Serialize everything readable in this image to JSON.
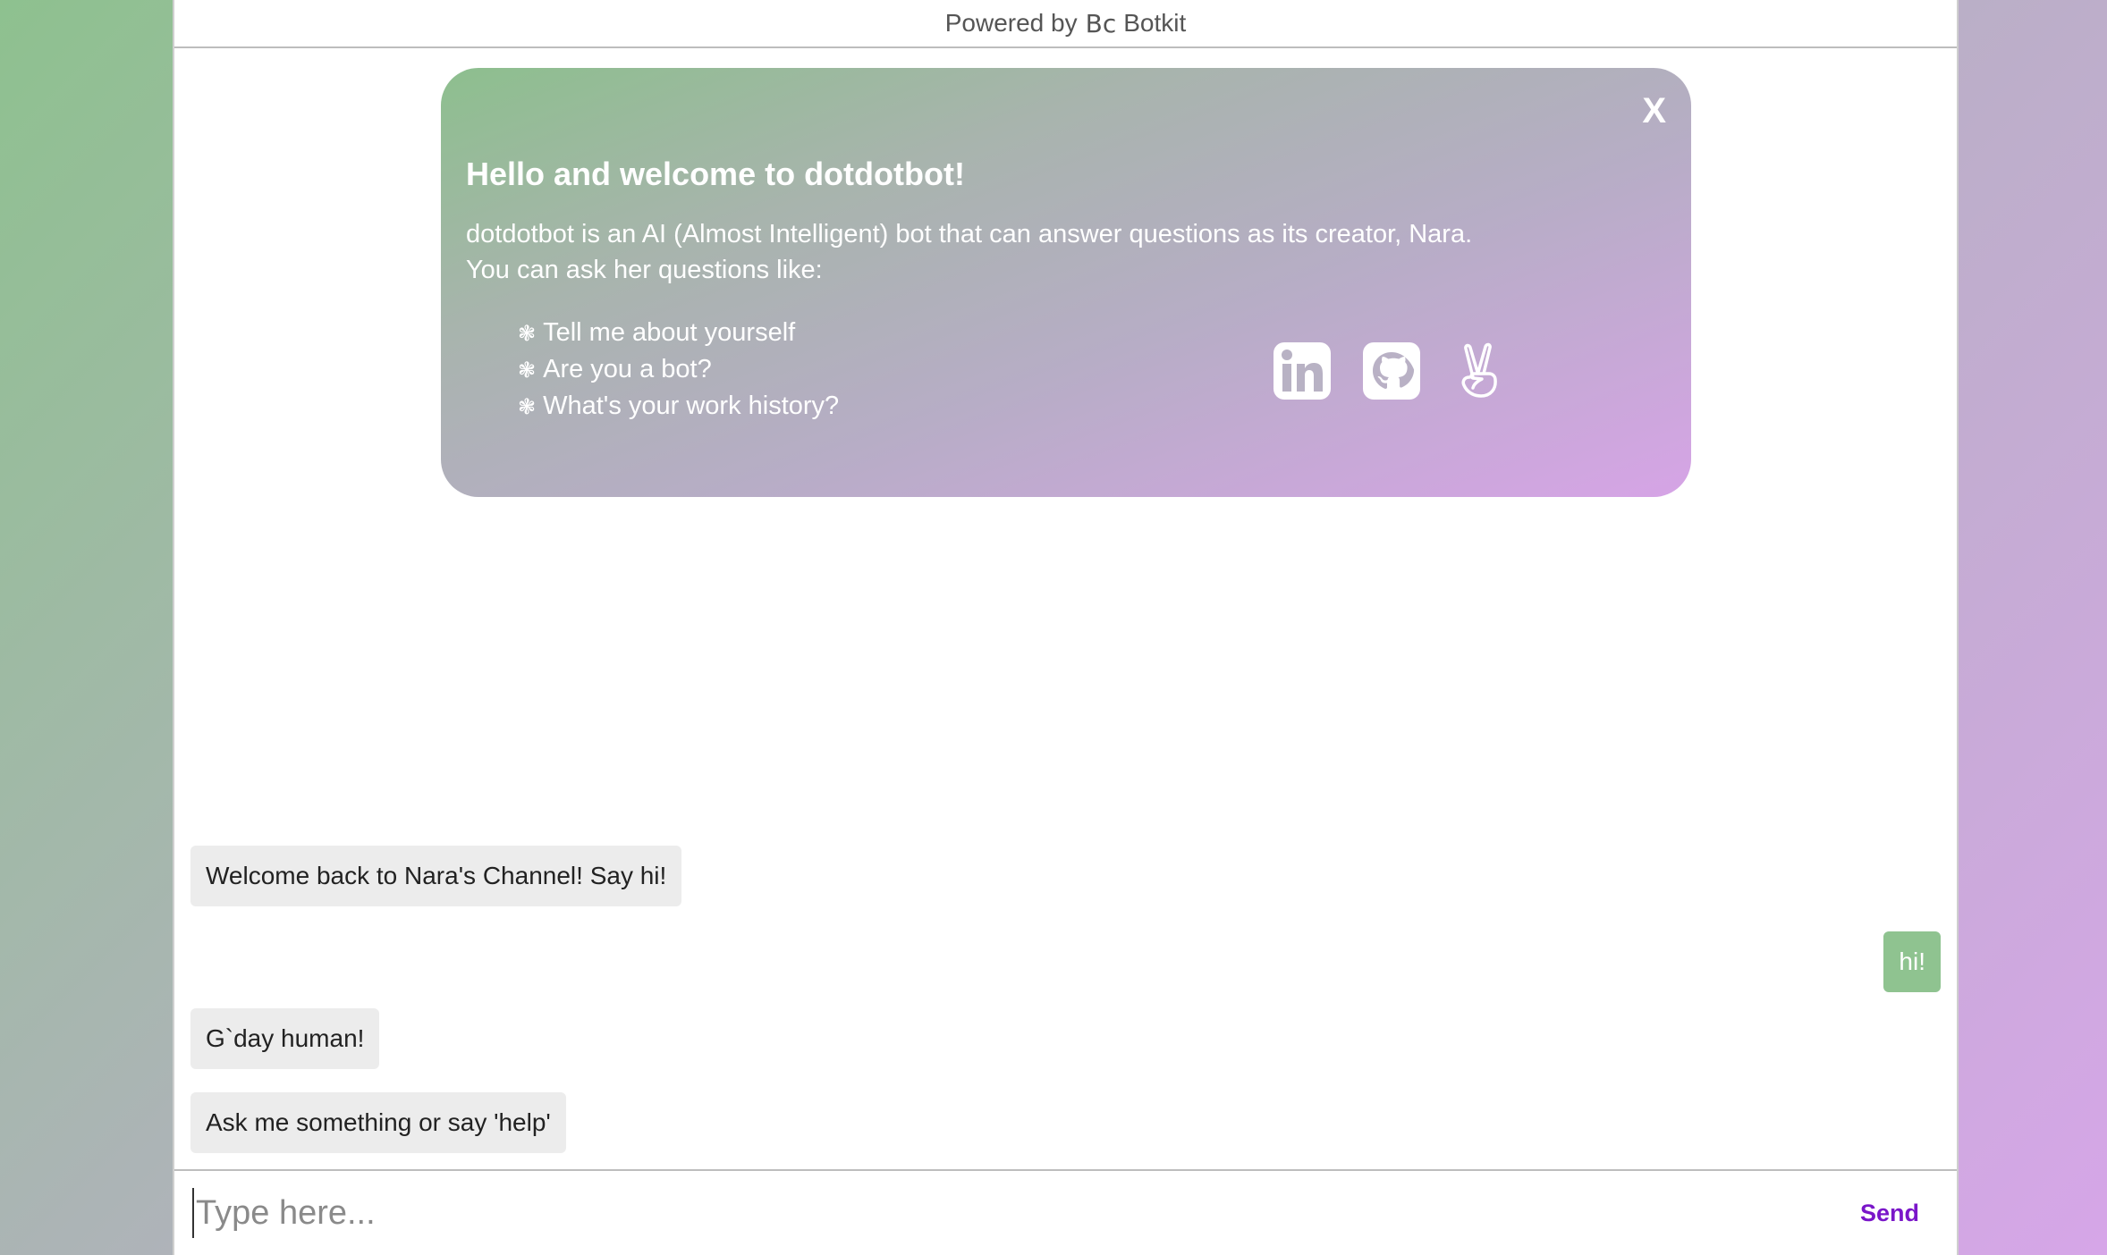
{
  "header": {
    "powered_by": "Powered by",
    "logo_text": "Bc",
    "brand": "Botkit"
  },
  "welcome": {
    "close_label": "X",
    "title": "Hello and welcome to dotdotbot!",
    "intro_line1": "dotdotbot is an AI (Almost Intelligent) bot that can answer questions as its creator, Nara.",
    "intro_line2": "You can ask her questions like:",
    "bullet": "❃",
    "questions": [
      "Tell me about yourself",
      "Are you a bot?",
      "What's your work history?"
    ],
    "social_icons": [
      "linkedin-icon",
      "github-icon",
      "angellist-icon"
    ]
  },
  "messages": [
    {
      "from": "bot",
      "text": "Welcome back to Nara's Channel! Say hi!"
    },
    {
      "from": "user",
      "text": "hi!"
    },
    {
      "from": "bot",
      "text": "G`day human!"
    },
    {
      "from": "bot",
      "text": "Ask me something or say 'help'"
    }
  ],
  "composer": {
    "placeholder": "Type here...",
    "send_label": "Send"
  },
  "colors": {
    "user_bubble": "#8fc390",
    "bot_bubble": "#ececec",
    "send_text": "#7a16c9"
  }
}
